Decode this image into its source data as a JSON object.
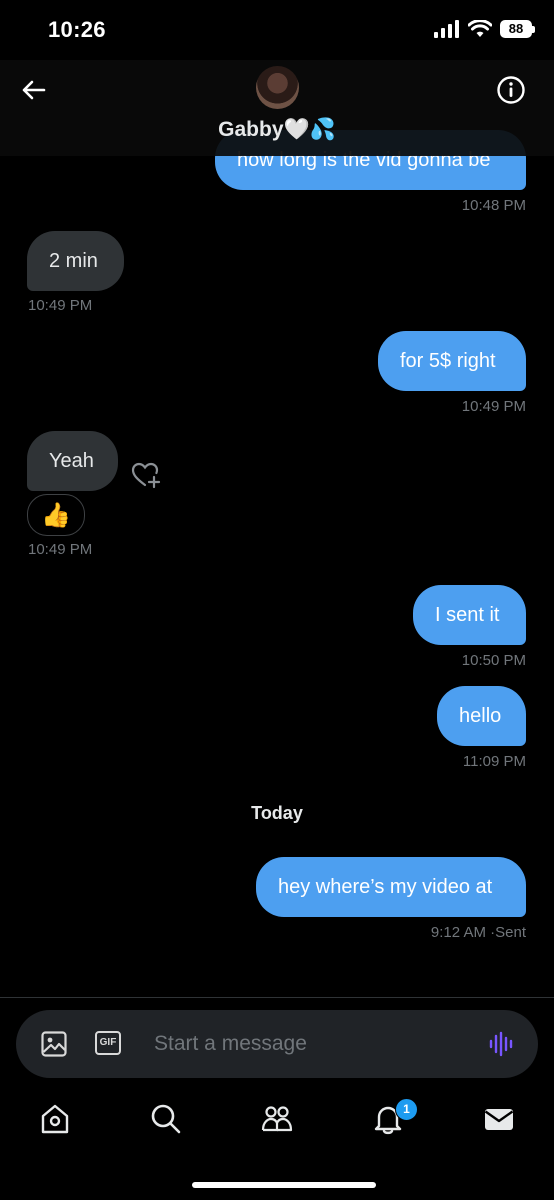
{
  "status": {
    "time": "10:26",
    "battery": "88"
  },
  "header": {
    "name": "Gabby",
    "name_emoji": "🤍💦"
  },
  "messages": [
    {
      "dir": "out",
      "text": "how long is the vid gonna be",
      "time": "10:48 PM"
    },
    {
      "dir": "in",
      "text": "2 min",
      "time": "10:49 PM"
    },
    {
      "dir": "out",
      "text": "for 5$ right",
      "time": "10:49 PM"
    },
    {
      "dir": "in",
      "text": "Yeah",
      "time": "10:49 PM",
      "reaction": "👍"
    },
    {
      "dir": "out",
      "text": "I sent it",
      "time": "10:50 PM"
    },
    {
      "dir": "out",
      "text": "hello",
      "time": "11:09 PM"
    },
    {
      "dir": "out",
      "text": "hey where’s my video at",
      "time": "9:12 AM",
      "status": "Sent"
    }
  ],
  "day_separator": "Today",
  "composer": {
    "placeholder": "Start a message",
    "gif_label": "GIF"
  },
  "tabbar": {
    "notifications_badge": "1"
  },
  "colors": {
    "accent": "#1d9bf0",
    "outgoing_bubble": "#4d9ff0",
    "incoming_bubble": "#2f3336",
    "voice": "#7856ff"
  }
}
